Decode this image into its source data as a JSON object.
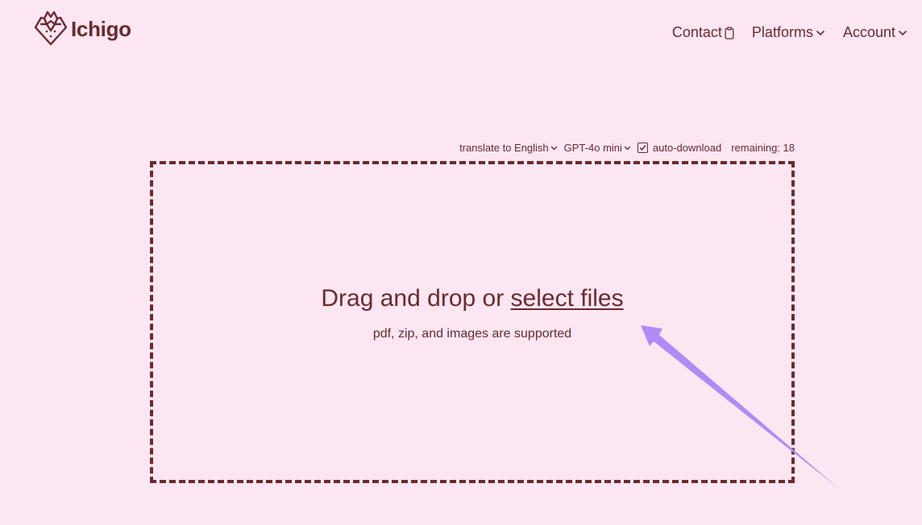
{
  "app": {
    "name": "Ichigo",
    "logo_icon": "strawberry-logo-icon"
  },
  "nav": {
    "contact": "Contact",
    "platforms": "Platforms",
    "account": "Account"
  },
  "options": {
    "translate": "translate to English",
    "model": "GPT-4o mini",
    "auto_download_label": "auto-download",
    "auto_download_checked": true,
    "remaining": "remaining: 18"
  },
  "dropzone": {
    "title_prefix": "Drag and drop or ",
    "title_link": "select files",
    "subtitle": "pdf, zip, and images are supported"
  },
  "colors": {
    "background": "#fbe6f1",
    "brand": "#6b2a2e",
    "annotation_arrow": "#b28af5"
  }
}
